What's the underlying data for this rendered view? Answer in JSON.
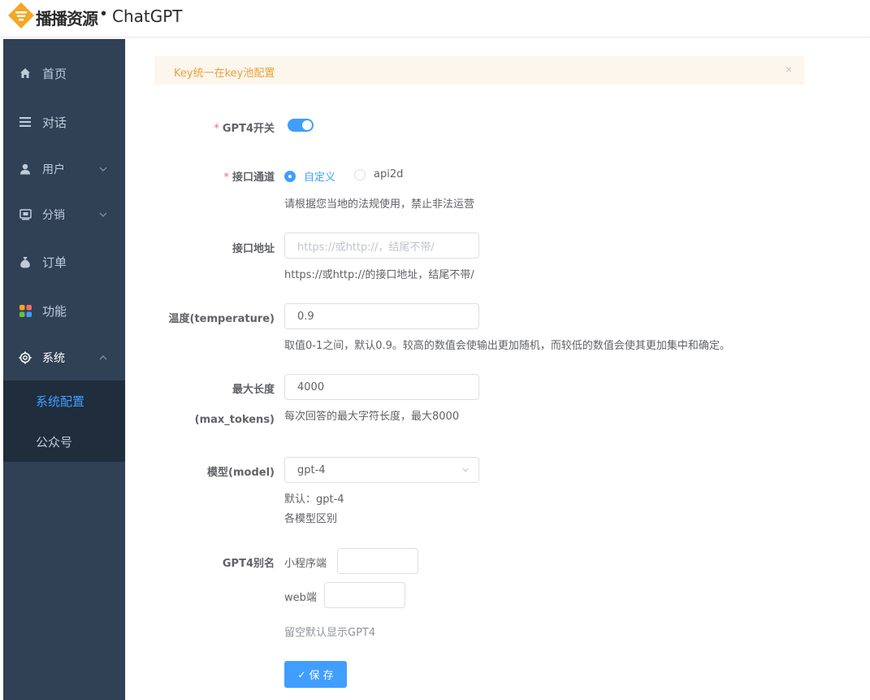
{
  "header": {
    "brand": "播播资源",
    "dot": "•",
    "app_name": "ChatGPT"
  },
  "sidebar": {
    "items": [
      {
        "label": "首页",
        "icon": "home-icon"
      },
      {
        "label": "对话",
        "icon": "menu-icon"
      },
      {
        "label": "用户",
        "icon": "user-icon"
      },
      {
        "label": "分销",
        "icon": "distribution-icon"
      },
      {
        "label": "订单",
        "icon": "money-bag-icon"
      },
      {
        "label": "功能",
        "icon": "apps-icon"
      },
      {
        "label": "系统",
        "icon": "gear-icon"
      }
    ],
    "sub_items": [
      {
        "label": "系统配置",
        "active": true
      },
      {
        "label": "公众号",
        "active": false
      }
    ]
  },
  "alert": {
    "text": "Key统一在key池配置",
    "close": "×"
  },
  "form": {
    "gpt4_switch": {
      "label": "GPT4开关",
      "required": "*",
      "value": true
    },
    "channel": {
      "label": "接口通道",
      "required": "*",
      "options": [
        "自定义",
        "api2d"
      ],
      "selected": "自定义",
      "hint": "请根据您当地的法规使用，禁止非法运营"
    },
    "api_url": {
      "label": "接口地址",
      "placeholder": "https://或http://，结尾不带/",
      "value": "",
      "hint": "https://或http://的接口地址，结尾不带/"
    },
    "temperature": {
      "label": "温度(temperature)",
      "value": "0.9",
      "hint": "取值0-1之间，默认0.9。较高的数值会使输出更加随机，而较低的数值会使其更加集中和确定。"
    },
    "max_tokens": {
      "label": "最大长度",
      "label2": "(max_tokens)",
      "value": "4000",
      "hint": "每次回答的最大字符长度，最大8000"
    },
    "model": {
      "label": "模型(model)",
      "value": "gpt-4",
      "hint1": "默认：gpt-4",
      "hint2": "各模型区别"
    },
    "alias": {
      "label": "GPT4别名",
      "mini_label": "小程序端",
      "mini_value": "",
      "web_label": "web端",
      "web_value": "",
      "hint": "留空默认显示GPT4"
    },
    "save_label": "保 存"
  },
  "colors": {
    "primary": "#409eff",
    "sidebar_bg": "#304156",
    "submenu_bg": "#1f2d3d",
    "alert_bg": "#fdf6ec",
    "alert_text": "#e6a23c",
    "required": "#f56c6c"
  }
}
